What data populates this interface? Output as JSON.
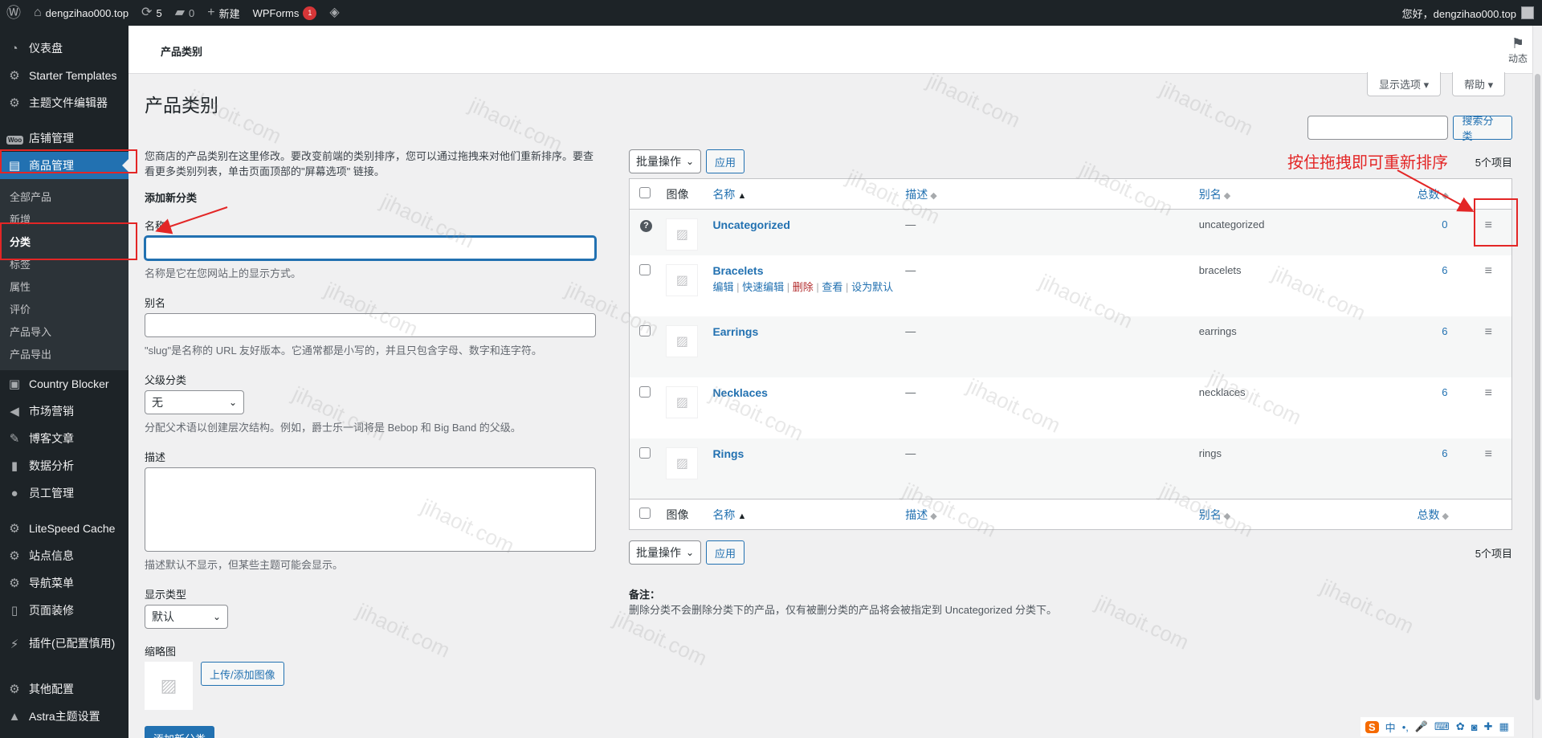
{
  "adminbar": {
    "site_name": "dengzihao000.top",
    "updates_count": "5",
    "comments_count": "0",
    "new_label": "新建",
    "wpforms_label": "WPForms",
    "wpforms_count": "1",
    "greeting": "您好，dengzihao000.top"
  },
  "sidebar": {
    "items": [
      {
        "label": "仪表盘",
        "icon": "dashboard-icon"
      },
      {
        "label": "Starter Templates",
        "icon": "gear-icon"
      },
      {
        "label": "主题文件编辑器",
        "icon": "gear-icon"
      },
      {
        "label": "店铺管理",
        "icon": "woo-icon"
      },
      {
        "label": "商品管理",
        "icon": "archive-icon"
      },
      {
        "label": "Country Blocker",
        "icon": "ip-icon"
      },
      {
        "label": "市场营销",
        "icon": "megaphone-icon"
      },
      {
        "label": "博客文章",
        "icon": "pin-icon"
      },
      {
        "label": "数据分析",
        "icon": "chart-icon"
      },
      {
        "label": "员工管理",
        "icon": "user-icon"
      },
      {
        "label": "LiteSpeed Cache",
        "icon": "gear-icon"
      },
      {
        "label": "站点信息",
        "icon": "gear-icon"
      },
      {
        "label": "导航菜单",
        "icon": "gear-icon"
      },
      {
        "label": "页面装修",
        "icon": "page-icon"
      },
      {
        "label": "插件(已配置慎用)",
        "icon": "plugin-icon"
      },
      {
        "label": "其他配置",
        "icon": "gear-icon"
      },
      {
        "label": "Astra主题设置",
        "icon": "astra-icon"
      }
    ],
    "woo_badge": "Woo",
    "submenu": [
      "全部产品",
      "新增",
      "分类",
      "标签",
      "属性",
      "评价",
      "产品导入",
      "产品导出"
    ]
  },
  "header": {
    "strip_title": "产品类别",
    "activity_label": "动态",
    "screen_options": "显示选项 ▾",
    "help": "帮助 ▾"
  },
  "page": {
    "title": "产品类别",
    "intro": "您商店的产品类别在这里修改。要改变前端的类别排序，您可以通过拖拽来对他们重新排序。要查看更多类别列表，单击页面顶部的\"屏幕选项\" 链接。",
    "add_new_title": "添加新分类",
    "name_label": "名称",
    "name_help": "名称是它在您网站上的显示方式。",
    "slug_label": "别名",
    "slug_help": "\"slug\"是名称的 URL 友好版本。它通常都是小写的，并且只包含字母、数字和连字符。",
    "parent_label": "父级分类",
    "parent_value": "无",
    "parent_help": "分配父术语以创建层次结构。例如，爵士乐一词将是 Bebop 和 Big Band 的父级。",
    "desc_label": "描述",
    "desc_help": "描述默认不显示，但某些主题可能会显示。",
    "display_type_label": "显示类型",
    "display_type_value": "默认",
    "thumb_label": "缩略图",
    "upload_button": "上传/添加图像",
    "submit_button": "添加新分类"
  },
  "list": {
    "search_button": "搜索分类",
    "bulk_label": "批量操作",
    "apply_label": "应用",
    "count_text": "5个项目",
    "columns": {
      "image": "图像",
      "name": "名称",
      "description": "描述",
      "slug": "别名",
      "count": "总数"
    },
    "rows": [
      {
        "name": "Uncategorized",
        "desc": "—",
        "slug": "uncategorized",
        "count": "0"
      },
      {
        "name": "Bracelets",
        "desc": "—",
        "slug": "bracelets",
        "count": "6"
      },
      {
        "name": "Earrings",
        "desc": "—",
        "slug": "earrings",
        "count": "6"
      },
      {
        "name": "Necklaces",
        "desc": "—",
        "slug": "necklaces",
        "count": "6"
      },
      {
        "name": "Rings",
        "desc": "—",
        "slug": "rings",
        "count": "6"
      }
    ],
    "row_actions": {
      "edit": "编辑",
      "quick_edit": "快速编辑",
      "delete": "删除",
      "view": "查看",
      "set_default": "设为默认"
    }
  },
  "notes": {
    "title": "备注：",
    "text": "删除分类不会删除分类下的产品，仅有被删分类的产品将会被指定到 Uncategorized 分类下。"
  },
  "annotation": {
    "drag_hint": "按住拖拽即可重新排序",
    "color": "#e32626"
  },
  "watermark": "jihaoit.com",
  "ime": {
    "logo": "S",
    "lang": "中"
  },
  "colors": {
    "accent": "#2271b1",
    "sidebar": "#1d2327",
    "danger": "#b32d2e"
  }
}
